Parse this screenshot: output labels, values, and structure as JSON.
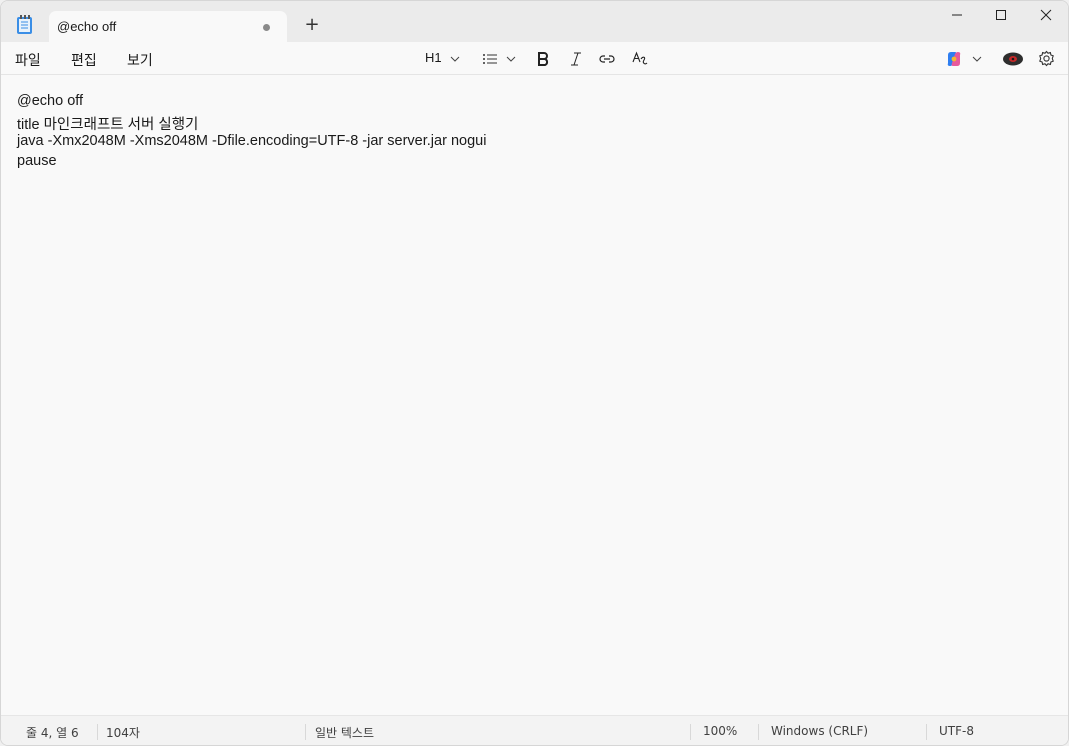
{
  "tab": {
    "title": "@echo off",
    "new_tab": "+"
  },
  "menu": {
    "file": "파일",
    "edit": "편집",
    "view": "보기"
  },
  "toolbar": {
    "heading": "H1"
  },
  "document": {
    "lines": [
      "@echo off",
      "title 마인크래프트 서버 실행기",
      "java -Xmx2048M -Xms2048M -Dfile.encoding=UTF-8 -jar server.jar nogui",
      "pause"
    ]
  },
  "status": {
    "position": "줄 4, 열 6",
    "chars": "104자",
    "format": "일반 텍스트",
    "zoom": "100%",
    "line_ending": "Windows (CRLF)",
    "encoding": "UTF-8"
  },
  "colors": {
    "accent": "#0067c0",
    "titlebar": "#ebebeb",
    "editor": "#f9f9f9"
  }
}
